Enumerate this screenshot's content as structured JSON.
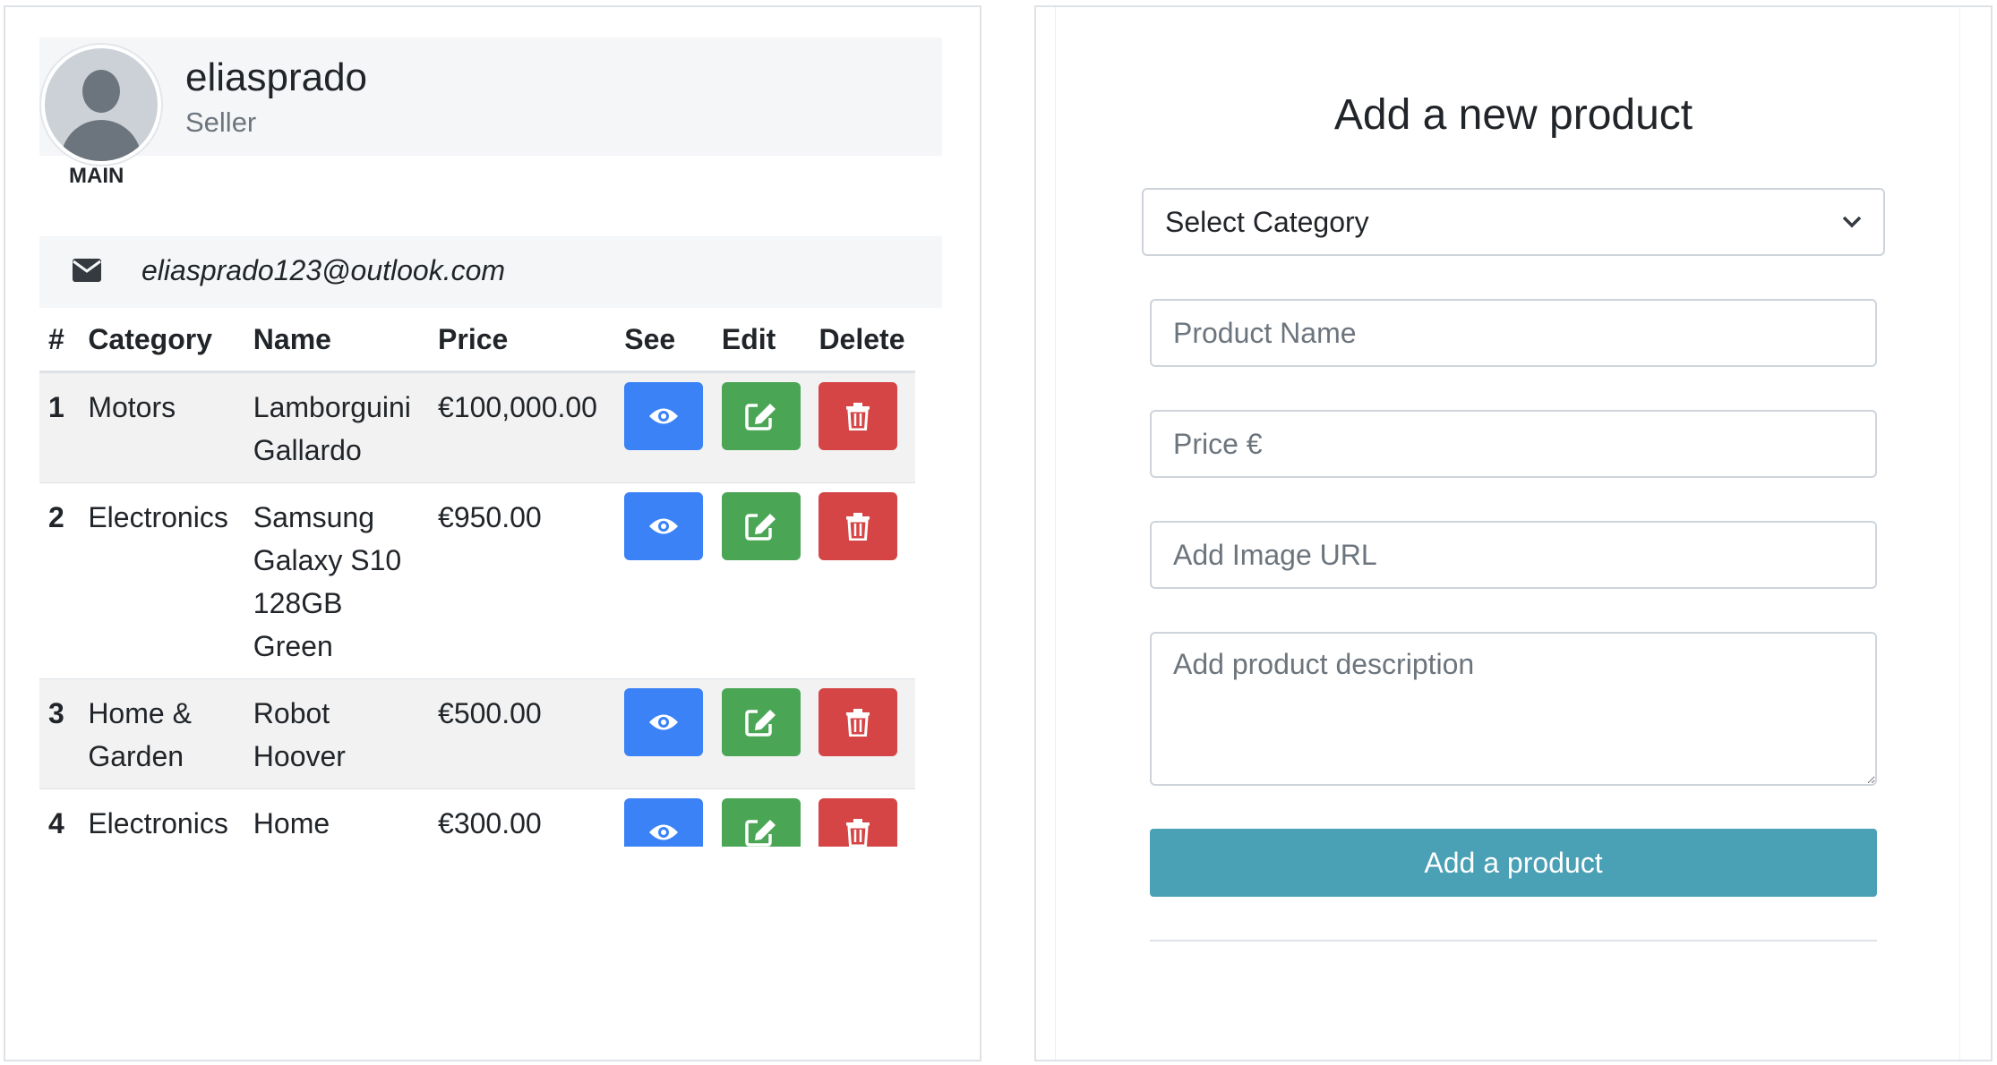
{
  "profile": {
    "username": "eliasprado",
    "role": "Seller",
    "main_label": "MAIN",
    "email": "eliasprado123@outlook.com"
  },
  "table": {
    "headers": [
      "#",
      "Category",
      "Name",
      "Price",
      "See",
      "Edit",
      "Delete"
    ],
    "rows": [
      {
        "num": "1",
        "category": "Motors",
        "name": "Lamborguini Gallardo",
        "price": "€100,000.00"
      },
      {
        "num": "2",
        "category": "Electronics",
        "name": "Samsung Galaxy S10 128GB Green",
        "price": "€950.00"
      },
      {
        "num": "3",
        "category": "Home & Garden",
        "name": "Robot Hoover",
        "price": "€500.00"
      },
      {
        "num": "4",
        "category": "Electronics",
        "name": "Home Cinema",
        "price": "€300.00"
      }
    ]
  },
  "form": {
    "title": "Add a new product",
    "category_select": "Select Category",
    "product_name_placeholder": "Product Name",
    "price_placeholder": "Price €",
    "image_url_placeholder": "Add Image URL",
    "description_placeholder": "Add product description",
    "submit_label": "Add a product"
  },
  "icons": {
    "see": "eye-icon",
    "edit": "edit-icon",
    "delete": "trash-icon",
    "email": "envelope-icon",
    "avatar": "user-avatar-icon",
    "select": "chevron-down-icon"
  },
  "colors": {
    "see_button": "#3b82f6",
    "edit_button": "#4aa655",
    "delete_button": "#d64545",
    "submit_button": "#4aa0b5"
  }
}
